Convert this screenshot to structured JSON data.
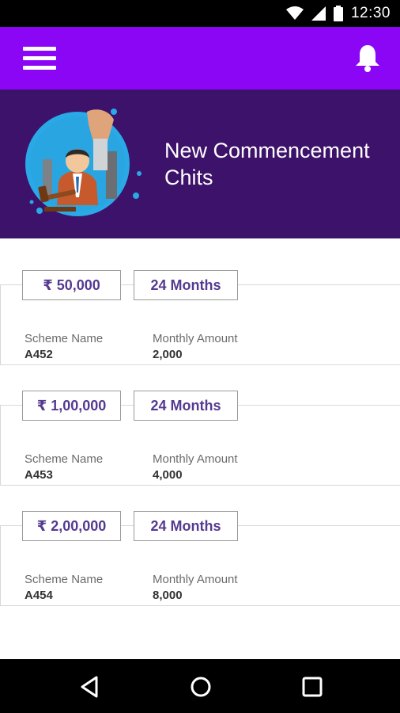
{
  "status_bar": {
    "time": "12:30",
    "icons": [
      "wifi-icon",
      "signal-icon",
      "battery-icon"
    ]
  },
  "app_bar": {
    "menu_icon": "hamburger-menu-icon",
    "notification_icon": "bell-icon",
    "color": "#8a06f5"
  },
  "banner": {
    "title": "New Commencement Chits",
    "illustration": "auction-gavel-illustration",
    "color": "#3d126a"
  },
  "schemes": [
    {
      "amount": "₹ 50,000",
      "duration": "24 Months",
      "scheme_label": "Scheme Name",
      "scheme_value": "A452",
      "monthly_label": "Monthly Amount",
      "monthly_value": "2,000"
    },
    {
      "amount": "₹ 1,00,000",
      "duration": "24 Months",
      "scheme_label": "Scheme Name",
      "scheme_value": "A453",
      "monthly_label": "Monthly Amount",
      "monthly_value": "4,000"
    },
    {
      "amount": "₹ 2,00,000",
      "duration": "24 Months",
      "scheme_label": "Scheme Name",
      "scheme_value": "A454",
      "monthly_label": "Monthly Amount",
      "monthly_value": "8,000"
    }
  ],
  "nav_bar": {
    "icons": [
      "back-triangle-icon",
      "home-circle-icon",
      "recents-square-icon"
    ]
  }
}
